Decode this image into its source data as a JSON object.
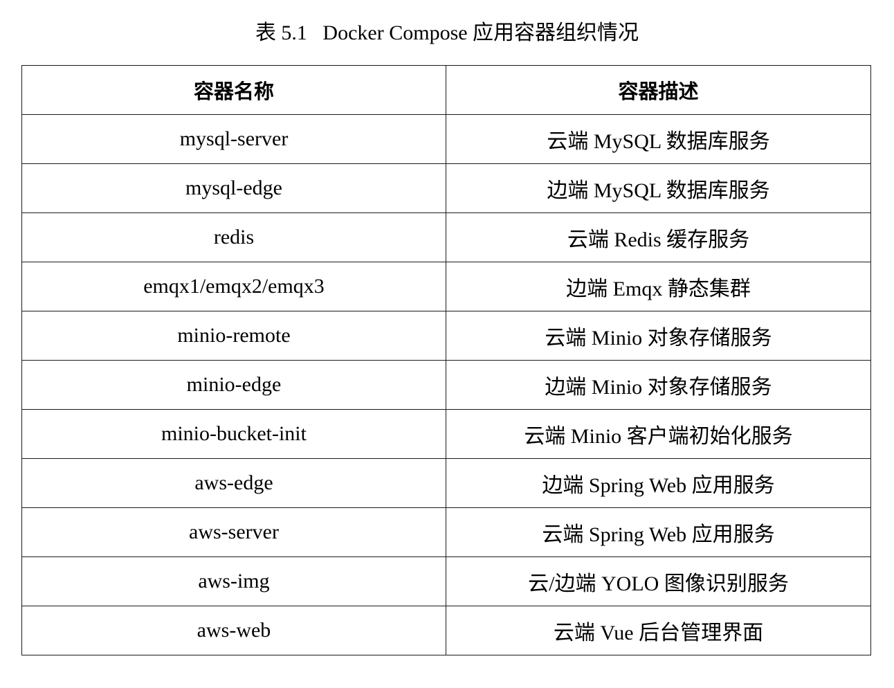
{
  "caption": "表 5.1   Docker Compose 应用容器组织情况",
  "table": {
    "headers": [
      "容器名称",
      "容器描述"
    ],
    "rows": [
      [
        "mysql-server",
        "云端 MySQL 数据库服务"
      ],
      [
        "mysql-edge",
        "边端 MySQL 数据库服务"
      ],
      [
        "redis",
        "云端 Redis 缓存服务"
      ],
      [
        "emqx1/emqx2/emqx3",
        "边端 Emqx 静态集群"
      ],
      [
        "minio-remote",
        "云端 Minio 对象存储服务"
      ],
      [
        "minio-edge",
        "边端 Minio 对象存储服务"
      ],
      [
        "minio-bucket-init",
        "云端 Minio 客户端初始化服务"
      ],
      [
        "aws-edge",
        "边端 Spring Web 应用服务"
      ],
      [
        "aws-server",
        "云端 Spring Web 应用服务"
      ],
      [
        "aws-img",
        "云/边端 YOLO 图像识别服务"
      ],
      [
        "aws-web",
        "云端 Vue 后台管理界面"
      ]
    ]
  }
}
